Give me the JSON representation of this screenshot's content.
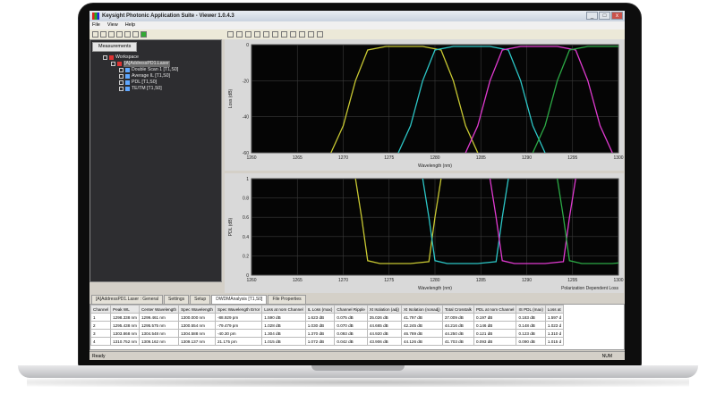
{
  "window": {
    "title": "Keysight Photonic Application Suite - Viewer 1.0.4.3",
    "min": "_",
    "max": "□",
    "close": "x"
  },
  "menu": [
    "File",
    "View",
    "Help"
  ],
  "left_panel": {
    "tab": "Measurements",
    "tree": [
      {
        "label": "Workspace",
        "indent": 0,
        "icon": "red"
      },
      {
        "label": "[A]AddressPD1.Laser",
        "indent": 1,
        "icon": "red",
        "selected": true
      },
      {
        "label": "Double Scan 1 [T1,S0]",
        "indent": 2,
        "icon": "blue"
      },
      {
        "label": "Average IL [T1,S0]",
        "indent": 2,
        "icon": "blue"
      },
      {
        "label": "PDL [T1,S0]",
        "indent": 2,
        "icon": "blue"
      },
      {
        "label": "TE/TM [T1,S0]",
        "indent": 2,
        "icon": "blue"
      }
    ]
  },
  "chart_data": [
    {
      "type": "line",
      "ylabel": "Loss (dB)",
      "xlabel": "Wavelength (nm)",
      "xlim": [
        1500,
        1560
      ],
      "ylim": [
        -60,
        0
      ],
      "yticks": [
        "0",
        "-20",
        "-40",
        "-60"
      ],
      "xticks": [
        "1260",
        "1265",
        "1270",
        "1275",
        "1280",
        "1285",
        "1290",
        "1295",
        "1300"
      ],
      "grid": true,
      "series": [
        {
          "color": "#c8c832",
          "values": [
            [
              1513,
              -60
            ],
            [
              1515,
              -45
            ],
            [
              1517,
              -20
            ],
            [
              1519,
              -3
            ],
            [
              1522,
              -1
            ],
            [
              1528,
              -1
            ],
            [
              1531,
              -3
            ],
            [
              1533,
              -20
            ],
            [
              1535,
              -45
            ],
            [
              1537,
              -60
            ]
          ]
        },
        {
          "color": "#2cc6c6",
          "values": [
            [
              1524,
              -60
            ],
            [
              1526,
              -45
            ],
            [
              1528,
              -20
            ],
            [
              1530,
              -3
            ],
            [
              1533,
              -1
            ],
            [
              1539,
              -1
            ],
            [
              1542,
              -3
            ],
            [
              1544,
              -20
            ],
            [
              1546,
              -45
            ],
            [
              1548,
              -60
            ]
          ]
        },
        {
          "color": "#e03ad0",
          "values": [
            [
              1535,
              -60
            ],
            [
              1537,
              -45
            ],
            [
              1539,
              -20
            ],
            [
              1541,
              -3
            ],
            [
              1544,
              -1
            ],
            [
              1550,
              -1
            ],
            [
              1553,
              -3
            ],
            [
              1555,
              -20
            ],
            [
              1557,
              -45
            ],
            [
              1559,
              -60
            ]
          ]
        },
        {
          "color": "#2caa46",
          "values": [
            [
              1546,
              -60
            ],
            [
              1548,
              -45
            ],
            [
              1550,
              -20
            ],
            [
              1552,
              -3
            ],
            [
              1555,
              -1
            ],
            [
              1561,
              -1
            ],
            [
              1564,
              -3
            ],
            [
              1566,
              -20
            ],
            [
              1568,
              -45
            ],
            [
              1570,
              -60
            ]
          ]
        }
      ]
    },
    {
      "type": "line",
      "ylabel": "PDL (dB)",
      "xlabel": "Wavelength (nm)",
      "xlabel_right": "Polarization Dependent Loss",
      "xlim": [
        1500,
        1560
      ],
      "ylim": [
        0,
        1
      ],
      "yticks": [
        "1",
        "0.8",
        "0.6",
        "0.4",
        "0.2",
        "0"
      ],
      "xticks": [
        "1260",
        "1265",
        "1270",
        "1275",
        "1280",
        "1285",
        "1290",
        "1295",
        "1300"
      ],
      "grid": true,
      "series": [
        {
          "color": "#c8c832",
          "values": [
            [
              1517,
              1
            ],
            [
              1518,
              0.6
            ],
            [
              1519,
              0.15
            ],
            [
              1521,
              0.12
            ],
            [
              1526,
              0.12
            ],
            [
              1529,
              0.14
            ],
            [
              1530,
              0.6
            ],
            [
              1531,
              1
            ]
          ]
        },
        {
          "color": "#2cc6c6",
          "values": [
            [
              1528,
              1
            ],
            [
              1529,
              0.6
            ],
            [
              1530,
              0.15
            ],
            [
              1532,
              0.12
            ],
            [
              1537,
              0.12
            ],
            [
              1540,
              0.14
            ],
            [
              1541,
              0.6
            ],
            [
              1542,
              1
            ]
          ]
        },
        {
          "color": "#e03ad0",
          "values": [
            [
              1539,
              1
            ],
            [
              1540,
              0.6
            ],
            [
              1541,
              0.15
            ],
            [
              1543,
              0.12
            ],
            [
              1548,
              0.12
            ],
            [
              1551,
              0.14
            ],
            [
              1552,
              0.6
            ],
            [
              1553,
              1
            ]
          ]
        },
        {
          "color": "#2caa46",
          "values": [
            [
              1550,
              1
            ],
            [
              1551,
              0.6
            ],
            [
              1552,
              0.15
            ],
            [
              1554,
              0.12
            ],
            [
              1559,
              0.12
            ],
            [
              1562,
              0.14
            ],
            [
              1563,
              0.6
            ],
            [
              1564,
              1
            ]
          ]
        }
      ]
    }
  ],
  "bottom_tabs": [
    {
      "label": "[A]AddressPD1.Laser : General",
      "active": false
    },
    {
      "label": "Settings",
      "active": false
    },
    {
      "label": "Setup",
      "active": false
    },
    {
      "label": "DWDMAnalysis [T1,S0]",
      "active": true
    },
    {
      "label": "File Properties",
      "active": false
    }
  ],
  "table": {
    "headers": [
      "Channel",
      "Peak WL",
      "Center Wavelength",
      "Spec Wavelength",
      "Spec Wavelength Error",
      "Loss at nom Channel",
      "IL Loss (max)",
      "Channel Ripple",
      "Xt Isolation (adj)",
      "Xt Isolation (nonadj)",
      "Total Crosstalk",
      "PDL at nom Channel",
      "IS PDL (max)",
      "Loss at"
    ],
    "rows": [
      [
        "1",
        "1298.338 nm",
        "1299.461 nm",
        "1300.000 nm",
        "-88.929 pm",
        "1.590 dB",
        "1.623 dB",
        "0.075 dB",
        "35.026 dB",
        "41.797 dB",
        "37.009 dB",
        "0.197 dB",
        "0.183 dB",
        "1.597 d"
      ],
      [
        "2",
        "1295.438 nm",
        "1295.575 nm",
        "1300.554 nm",
        "-79.479 pm",
        "1.028 dB",
        "1.030 dB",
        "0.070 dB",
        "44.665 dB",
        "42.245 dB",
        "44.216 dB",
        "0.146 dB",
        "0.148 dB",
        "1.023 d"
      ],
      [
        "3",
        "1303.868 nm",
        "1304.548 nm",
        "1304.588 nm",
        "-40.30 pm",
        "1.304 dB",
        "1.370 dB",
        "0.093 dB",
        "44.920 dB",
        "46.789 dB",
        "44.250 dB",
        "0.121 dB",
        "0.123 dB",
        "1.310 d"
      ],
      [
        "4",
        "1310.752 nm",
        "1309.162 nm",
        "1309.137 nm",
        "21.175 pm",
        "1.015 dB",
        "1.072 dB",
        "0.042 dB",
        "43.906 dB",
        "44.126 dB",
        "41.703 dB",
        "0.093 dB",
        "0.090 dB",
        "1.015 d"
      ]
    ]
  },
  "status": {
    "left": "Ready",
    "right": "NUM"
  }
}
